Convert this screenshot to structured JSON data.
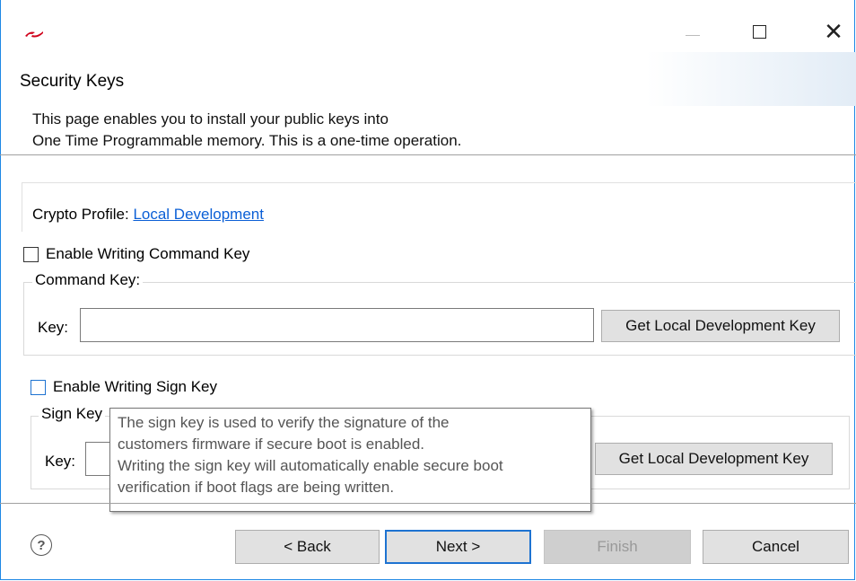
{
  "window": {
    "minimize_glyph": "",
    "close_glyph": "✕"
  },
  "page": {
    "title": "Security Keys",
    "description_line1": "This page enables you to install your public keys into",
    "description_line2": "One Time Programmable memory.  This is a one-time operation."
  },
  "profile": {
    "label": "Crypto Profile:",
    "link": "Local Development"
  },
  "command_key": {
    "checkbox_label": "Enable Writing Command Key",
    "checked": false,
    "group_label": "Command Key:",
    "key_label": "Key:",
    "value": "",
    "button": "Get Local Development Key"
  },
  "sign_key": {
    "checkbox_label": "Enable Writing Sign Key",
    "checked": false,
    "group_label": "Sign Key",
    "key_label": "Key:",
    "value": "",
    "button": "Get Local Development Key"
  },
  "tooltip": {
    "line1": "The sign key is used to verify the signature of the",
    "line2": "customers firmware if secure boot is enabled.",
    "line3": "Writing the sign key will automatically enable secure boot",
    "line4": "verification if boot flags are being written."
  },
  "footer": {
    "help_glyph": "?",
    "back": "< Back",
    "next": "Next >",
    "finish": "Finish",
    "cancel": "Cancel"
  },
  "colors": {
    "accent": "#1e73d1",
    "link": "#0b5fd6"
  }
}
